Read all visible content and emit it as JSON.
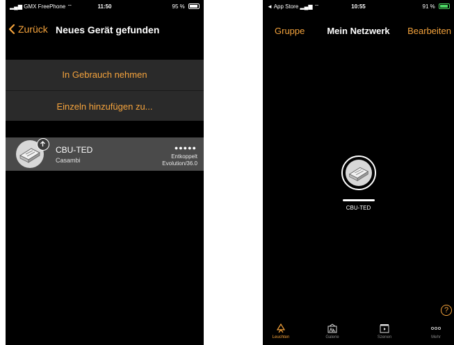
{
  "left_screen": {
    "status": {
      "carrier": "GMX FreePhone",
      "time": "11:50",
      "battery": "95 %",
      "battery_level": 0.95
    },
    "nav": {
      "back_label": "Zurück",
      "title": "Neues Gerät gefunden"
    },
    "actions": [
      "In Gebrauch nehmen",
      "Einzeln hinzufügen zu..."
    ],
    "device": {
      "name": "CBU-TED",
      "vendor": "Casambi",
      "signal_dots": "●●●●●",
      "state": "Entkoppelt",
      "firmware": "Evolution/36.0"
    }
  },
  "right_screen": {
    "status": {
      "back_app": "◄ App Store",
      "time": "10:55",
      "battery": "91 %",
      "battery_level": 0.91,
      "charging": true
    },
    "nav": {
      "left": "Gruppe",
      "title": "Mein Netzwerk",
      "right": "Bearbeiten"
    },
    "device_label": "CBU-TED",
    "help_glyph": "?",
    "tabs": [
      {
        "icon": "lamp-icon",
        "label": "Leuchten",
        "active": true
      },
      {
        "icon": "gallery-icon",
        "label": "Galerie",
        "active": false
      },
      {
        "icon": "scenes-icon",
        "label": "Szenen",
        "active": false
      },
      {
        "icon": "more-icon",
        "label": "Mehr",
        "active": false
      }
    ]
  },
  "colors": {
    "accent": "#f5a33c",
    "background": "#000000",
    "panel": "#2a2a2a",
    "row": "#4a4a4a"
  }
}
